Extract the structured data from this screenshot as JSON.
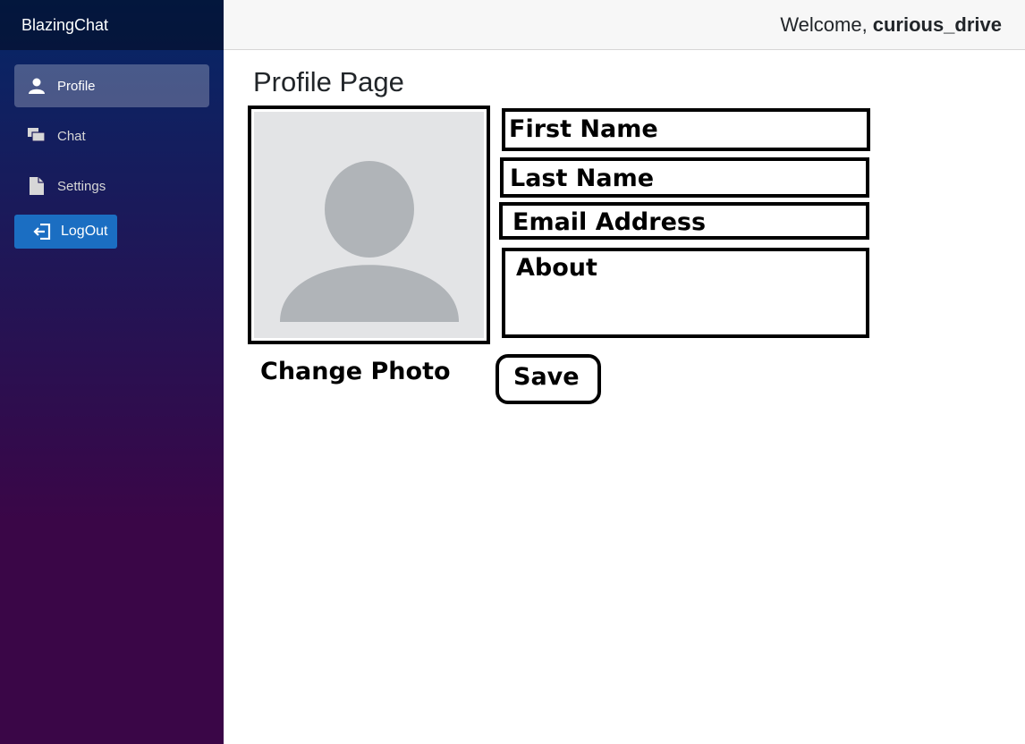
{
  "app": {
    "brand": "BlazingChat"
  },
  "header": {
    "welcome_label": "Welcome,",
    "username": "curious_drive"
  },
  "sidebar": {
    "items": [
      {
        "label": "Profile",
        "icon": "person-icon",
        "active": true
      },
      {
        "label": "Chat",
        "icon": "chat-icon",
        "active": false
      },
      {
        "label": "Settings",
        "icon": "document-icon",
        "active": false
      }
    ],
    "logout_label": "LogOut"
  },
  "main": {
    "title": "Profile Page",
    "fields": {
      "first_name": "First Name",
      "last_name": "Last Name",
      "email": "Email Address",
      "about": "About"
    },
    "change_photo_label": "Change Photo",
    "save_label": "Save"
  },
  "colors": {
    "sidebar_top": "#052767",
    "sidebar_bottom": "#3a0647",
    "logout_button": "#1b6ec2",
    "avatar_bg": "#e3e4e6",
    "avatar_fg": "#b0b4b8"
  }
}
